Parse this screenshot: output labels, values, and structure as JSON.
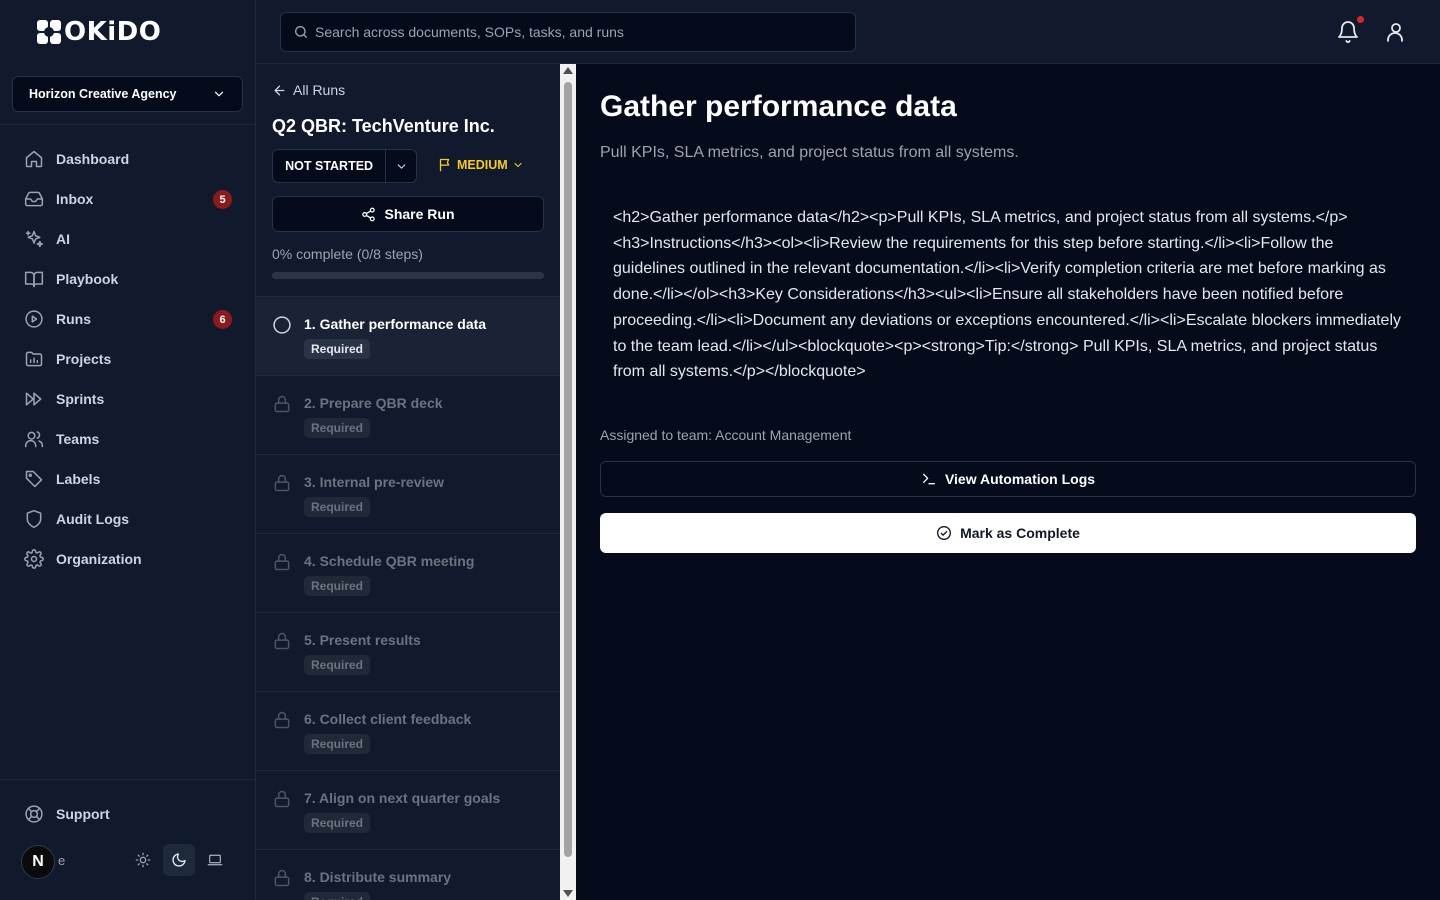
{
  "brand": {
    "logo_text": "OKiDO"
  },
  "org": {
    "name": "Horizon Creative Agency"
  },
  "nav": {
    "items": [
      {
        "label": "Dashboard",
        "icon": "home-icon",
        "badge": null
      },
      {
        "label": "Inbox",
        "icon": "inbox-icon",
        "badge": "5"
      },
      {
        "label": "AI",
        "icon": "sparkles-icon",
        "badge": null
      },
      {
        "label": "Playbook",
        "icon": "book-icon",
        "badge": null
      },
      {
        "label": "Runs",
        "icon": "play-circle-icon",
        "badge": "6"
      },
      {
        "label": "Projects",
        "icon": "folder-chart-icon",
        "badge": null
      },
      {
        "label": "Sprints",
        "icon": "fast-forward-icon",
        "badge": null
      },
      {
        "label": "Teams",
        "icon": "users-icon",
        "badge": null
      },
      {
        "label": "Labels",
        "icon": "tag-icon",
        "badge": null
      },
      {
        "label": "Audit Logs",
        "icon": "shield-icon",
        "badge": null
      },
      {
        "label": "Organization",
        "icon": "gear-icon",
        "badge": null
      }
    ],
    "support_label": "Support"
  },
  "user": {
    "initial": "N",
    "name_fragment": "e"
  },
  "search": {
    "placeholder": "Search across documents, SOPs, tasks, and runs"
  },
  "run": {
    "back_label": "All Runs",
    "title": "Q2 QBR: TechVenture Inc.",
    "status": "NOT STARTED",
    "priority": "MEDIUM",
    "share_label": "Share Run",
    "progress_text": "0% complete (0/8 steps)",
    "progress_fraction": 0,
    "steps": [
      {
        "title": "1. Gather performance data",
        "tag": "Required",
        "active": true
      },
      {
        "title": "2. Prepare QBR deck",
        "tag": "Required",
        "active": false
      },
      {
        "title": "3. Internal pre-review",
        "tag": "Required",
        "active": false
      },
      {
        "title": "4. Schedule QBR meeting",
        "tag": "Required",
        "active": false
      },
      {
        "title": "5. Present results",
        "tag": "Required",
        "active": false
      },
      {
        "title": "6. Collect client feedback",
        "tag": "Required",
        "active": false
      },
      {
        "title": "7. Align on next quarter goals",
        "tag": "Required",
        "active": false
      },
      {
        "title": "8. Distribute summary",
        "tag": "Required",
        "active": false
      }
    ]
  },
  "detail": {
    "title": "Gather performance data",
    "subtitle": "Pull KPIs, SLA metrics, and project status from all systems.",
    "body_raw": "<h2>Gather performance data</h2><p>Pull KPIs, SLA metrics, and project status from all systems.</p><h3>Instructions</h3><ol><li>Review the requirements for this step before starting.</li><li>Follow the guidelines outlined in the relevant documentation.</li><li>Verify completion criteria are met before marking as done.</li></ol><h3>Key Considerations</h3><ul><li>Ensure all stakeholders have been notified before proceeding.</li><li>Document any deviations or exceptions encountered.</li><li>Escalate blockers immediately to the team lead.</li></ul><blockquote><p><strong>Tip:</strong> Pull KPIs, SLA metrics, and project status from all systems.</p></blockquote>",
    "assigned_text": "Assigned to team: Account Management",
    "logs_label": "View Automation Logs",
    "complete_label": "Mark as Complete"
  },
  "colors": {
    "background": "#050b1a",
    "panel": "#111a2c",
    "badge": "#8b1a1a",
    "priority": "#facc15",
    "notification_dot": "#dc2626"
  }
}
